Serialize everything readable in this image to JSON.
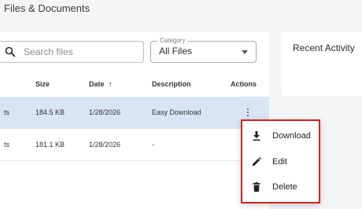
{
  "page": {
    "title": "Files & Documents"
  },
  "search": {
    "placeholder": "Search files",
    "value": ""
  },
  "category": {
    "legend": "Category",
    "value": "All Files"
  },
  "table": {
    "headers": {
      "size": "Size",
      "date": "Date",
      "description": "Description",
      "actions": "Actions"
    },
    "sort_icon": "↑",
    "rows": [
      {
        "name_fragment": "ts",
        "size": "184.5 KB",
        "date": "1/28/2026",
        "description": "Easy Download",
        "selected": true
      },
      {
        "name_fragment": "ts",
        "size": "181.1 KB",
        "date": "1/28/2026",
        "description": "-",
        "selected": false
      }
    ]
  },
  "activity": {
    "title": "Recent Activity"
  },
  "menu": {
    "items": [
      {
        "label": "Download",
        "icon": "download-icon"
      },
      {
        "label": "Edit",
        "icon": "edit-icon"
      },
      {
        "label": "Delete",
        "icon": "delete-icon"
      }
    ]
  },
  "colors": {
    "selected_row": "#d9e5f5",
    "menu_highlight_border": "#d9221e"
  }
}
